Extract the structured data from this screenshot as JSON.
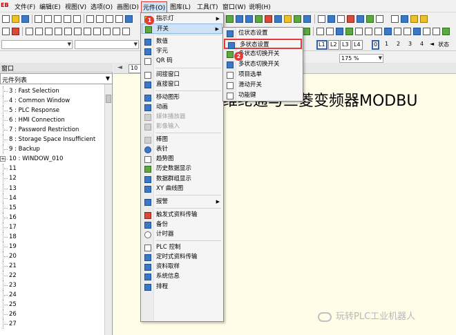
{
  "app": {
    "logo": "EB"
  },
  "menubar": [
    {
      "id": "file",
      "label": "文件(F)"
    },
    {
      "id": "edit",
      "label": "编辑(E)"
    },
    {
      "id": "view",
      "label": "视图(V)"
    },
    {
      "id": "options",
      "label": "选项(O)"
    },
    {
      "id": "draw",
      "label": "画图(D)"
    },
    {
      "id": "objects",
      "label": "元件(O)"
    },
    {
      "id": "library",
      "label": "图库(L)"
    },
    {
      "id": "tools",
      "label": "工具(T)"
    },
    {
      "id": "window",
      "label": "窗口(W)"
    },
    {
      "id": "help",
      "label": "说明(H)"
    }
  ],
  "toolbar": {
    "zoom_value": "175 %",
    "layer_buttons": [
      "L1",
      "L2",
      "L3",
      "L4"
    ],
    "state_buttons": [
      "0",
      "1",
      "2",
      "3",
      "4"
    ],
    "state_label": "状态",
    "combo1": "",
    "combo2": ""
  },
  "left_panel": {
    "header": "窗口",
    "list_header": "元件列表",
    "items": [
      "3 : Fast Selection",
      "4 : Common Window",
      "5 : PLC Response",
      "6 : HMI Connection",
      "7 : Password Restriction",
      "8 : Storage Space Insufficient",
      "9 : Backup",
      "10 : WINDOW_010",
      "11",
      "12",
      "13",
      "14",
      "15",
      "16",
      "17",
      "18",
      "19",
      "20",
      "21",
      "22",
      "23",
      "24",
      "25",
      "26",
      "27"
    ]
  },
  "workarea": {
    "tab_label": "10",
    "banner": "维纶通与三菱变频器MODBU",
    "watermark": "玩转PLC工业机器人"
  },
  "objects_menu": {
    "items": [
      {
        "label": "指示灯",
        "has_submenu": true,
        "icon": "indicator-icon"
      },
      {
        "label": "开关",
        "has_submenu": true,
        "icon": "switch-icon",
        "highlighted": true
      },
      {
        "sep": true
      },
      {
        "label": "数值",
        "icon": "numeric-icon"
      },
      {
        "label": "字元",
        "icon": "character-icon"
      },
      {
        "label": "QR 码",
        "icon": "qr-code-icon"
      },
      {
        "sep": true
      },
      {
        "label": "间接窗口",
        "icon": "indirect-window-icon"
      },
      {
        "label": "直接窗口",
        "icon": "direct-window-icon"
      },
      {
        "sep": true
      },
      {
        "label": "移动图形",
        "icon": "moving-shape-icon"
      },
      {
        "label": "动画",
        "icon": "animation-icon"
      },
      {
        "label": "媒体播放器",
        "icon": "media-player-icon",
        "disabled": true
      },
      {
        "label": "影像输入",
        "icon": "video-input-icon",
        "disabled": true
      },
      {
        "sep": true
      },
      {
        "label": "棒图",
        "icon": "bar-graph-icon"
      },
      {
        "label": "表针",
        "icon": "meter-icon"
      },
      {
        "label": "趋势图",
        "icon": "trend-display-icon"
      },
      {
        "label": "历史数据显示",
        "icon": "history-data-icon"
      },
      {
        "label": "数据群组显示",
        "icon": "data-group-icon"
      },
      {
        "label": "XY 曲线图",
        "icon": "xy-plot-icon"
      },
      {
        "sep": true
      },
      {
        "label": "报警",
        "has_submenu": true,
        "icon": "alarm-icon"
      },
      {
        "sep": true
      },
      {
        "label": "触发式资料传输",
        "icon": "trigger-transfer-icon"
      },
      {
        "label": "备份",
        "icon": "backup-icon"
      },
      {
        "label": "计时器",
        "icon": "timer-icon"
      },
      {
        "sep": true
      },
      {
        "label": "PLC 控制",
        "icon": "plc-control-icon"
      },
      {
        "label": "定时式资料传输",
        "icon": "scheduled-transfer-icon"
      },
      {
        "label": "资料取样",
        "icon": "data-sampling-icon"
      },
      {
        "label": "系统信息",
        "icon": "system-message-icon"
      },
      {
        "label": "排程",
        "icon": "scheduler-icon"
      }
    ]
  },
  "switch_submenu": {
    "items": [
      {
        "label": "位状态设置",
        "icon": "bit-state-icon"
      },
      {
        "label": "多状态设置",
        "icon": "word-state-icon",
        "boxed": true
      },
      {
        "label": "多状态切换开关",
        "icon": "multi-state-switch-icon"
      },
      {
        "label": "多状态切换开关",
        "icon": "multi-state-switch-2-icon"
      },
      {
        "label": "项目选单",
        "icon": "option-list-icon"
      },
      {
        "label": "滑动开关",
        "icon": "slide-switch-icon"
      },
      {
        "label": "功能键",
        "icon": "function-key-icon"
      }
    ]
  },
  "annotations": {
    "badge1": "1",
    "badge2": "2"
  },
  "colors": {
    "highlight": "#cde2f7",
    "annotation_red": "#e53935",
    "workarea_bg": "#fffde8"
  }
}
